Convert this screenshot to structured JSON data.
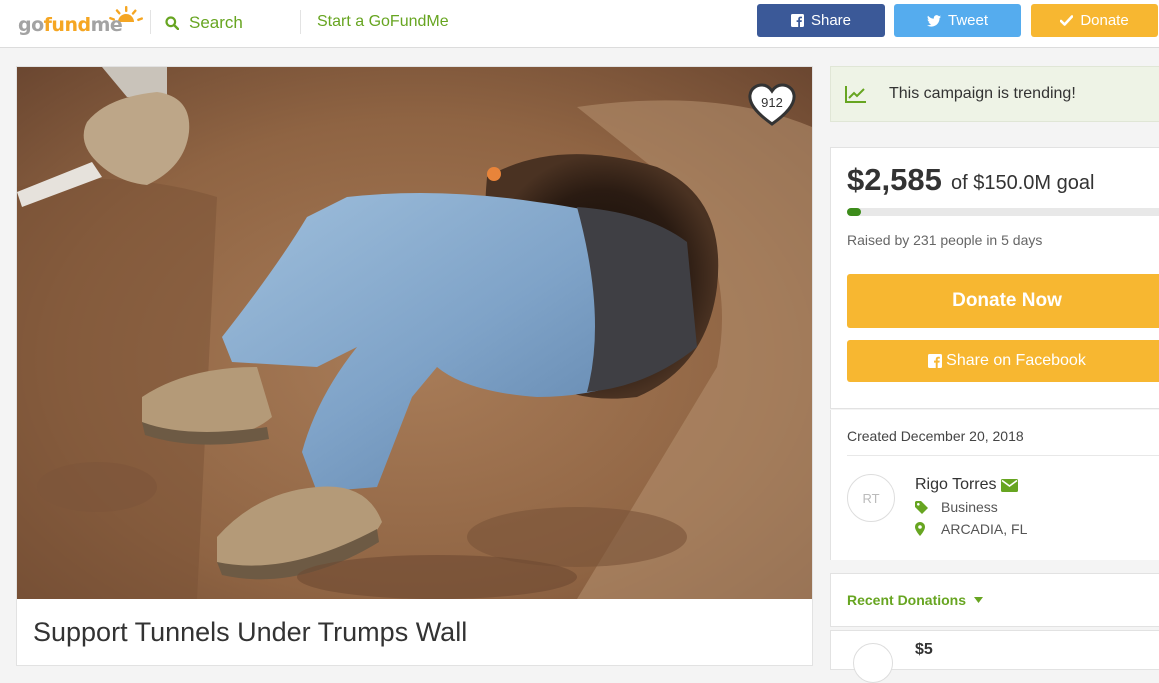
{
  "header": {
    "logo_prefix": "go",
    "logo_fund": "fund",
    "logo_suffix": "me",
    "search_label": "Search",
    "start_label": "Start a GoFundMe",
    "share_label": "Share",
    "tweet_label": "Tweet",
    "donate_label": "Donate"
  },
  "campaign": {
    "heart_count": "912",
    "title": "Support Tunnels Under Trumps Wall"
  },
  "sidebar": {
    "trending": "This campaign is trending!",
    "raised": "$2,585",
    "goal": "of $150.0M goal",
    "progress_fraction": 1.72e-05,
    "raised_by": "Raised by 231 people in 5 days",
    "donate_now": "Donate Now",
    "share_facebook": "Share on Facebook",
    "created": "Created December 20, 2018",
    "organizer": {
      "initials": "RT",
      "name": "Rigo Torres",
      "category": "Business",
      "location": "ARCADIA, FL"
    },
    "recent_donations": "Recent Donations",
    "first_donation_amount": "$5"
  },
  "colors": {
    "brand_green": "#67a521",
    "donate_orange": "#f7b731",
    "facebook_blue": "#3b5998",
    "twitter_blue": "#55acee"
  }
}
